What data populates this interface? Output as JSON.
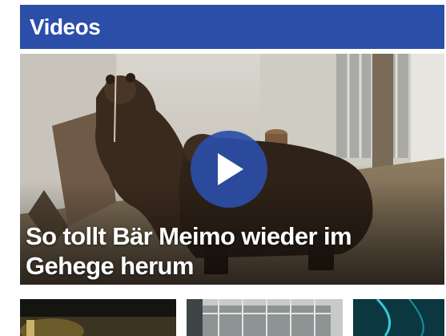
{
  "header": {
    "title": "Videos",
    "color": "#2b4ea8"
  },
  "featured_video": {
    "headline": "So tollt Bär Meimo wieder im Gehege herum",
    "play_icon": "play-icon",
    "thumbnail_subject": "brown bears in enclosure"
  },
  "thumbnails": [
    {
      "subject": "dark scene with warm light"
    },
    {
      "subject": "fenced enclosure"
    },
    {
      "subject": "teal underwater scene"
    }
  ]
}
